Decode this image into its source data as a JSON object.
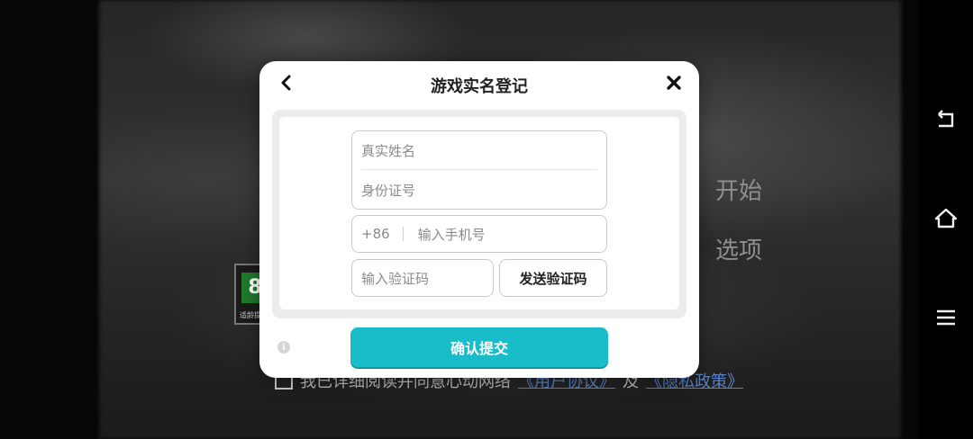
{
  "background": {
    "menu": [
      "开始",
      "选项"
    ],
    "age_rating": {
      "number": "8",
      "caption": "适龄提示"
    },
    "agreement": {
      "text": "我已详细阅读并同意心动网络",
      "link1": "《用户协议》",
      "conj": "及",
      "link2": "《隐私政策》"
    }
  },
  "dialog": {
    "title": "游戏实名登记",
    "fields": {
      "name_placeholder": "真实姓名",
      "id_placeholder": "身份证号",
      "phone_country_code": "+86",
      "phone_placeholder": "输入手机号",
      "code_placeholder": "输入验证码"
    },
    "send_code_label": "发送验证码",
    "submit_label": "确认提交",
    "info_icon_glyph": "i"
  },
  "colors": {
    "accent": "#19bdc9",
    "link": "#5a83c7"
  }
}
